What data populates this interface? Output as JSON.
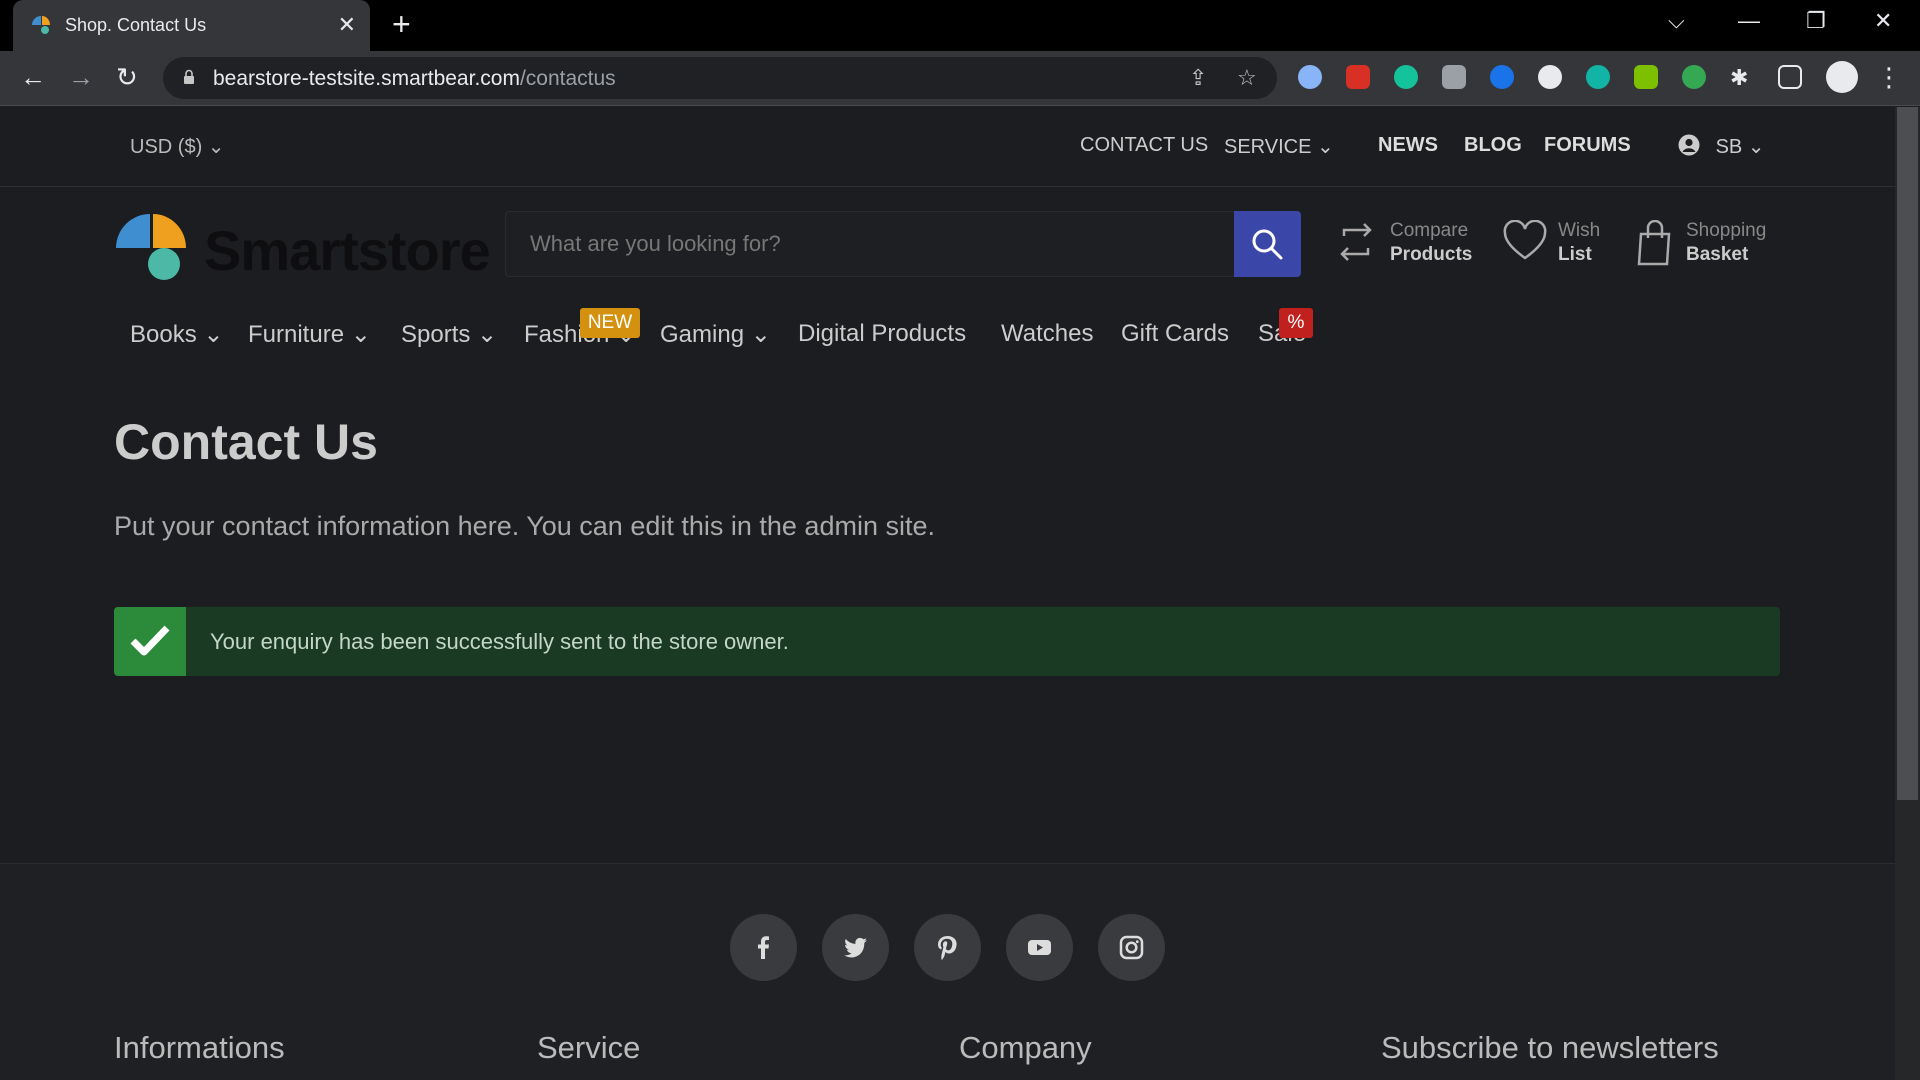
{
  "browser": {
    "tab_title": "Shop. Contact Us",
    "url_host": "bearstore-testsite.smartbear.com",
    "url_path": "/contactus"
  },
  "topbar": {
    "currency": "USD  ($)",
    "contact": "CONTACT US",
    "service": "SERVICE",
    "news": "NEWS",
    "blog": "BLOG",
    "forums": "FORUMS",
    "user": "SB"
  },
  "header": {
    "logo_text": "Smartstore",
    "search_placeholder": "What are you looking for?",
    "compare_l1": "Compare",
    "compare_l2": "Products",
    "wish_l1": "Wish",
    "wish_l2": "List",
    "basket_l1": "Shopping",
    "basket_l2": "Basket"
  },
  "categories": [
    "Books",
    "Furniture",
    "Sports",
    "Fashion",
    "Gaming",
    "Digital Products",
    "Watches",
    "Gift Cards",
    "Sale"
  ],
  "badges": {
    "new": "NEW",
    "sale": "%"
  },
  "main": {
    "title": "Contact Us",
    "intro": "Put your contact information here. You can edit this in the admin site.",
    "alert": "Your enquiry has been successfully sent to the store owner."
  },
  "footer": {
    "headings": [
      "Informations",
      "Service",
      "Company",
      "Subscribe to newsletters"
    ]
  },
  "colors": {
    "search_button": "#3b47a8",
    "success_bg": "#1a3a23",
    "success_icon": "#2c8a3b",
    "badge_new": "#d4900f",
    "badge_sale": "#c0201e"
  }
}
